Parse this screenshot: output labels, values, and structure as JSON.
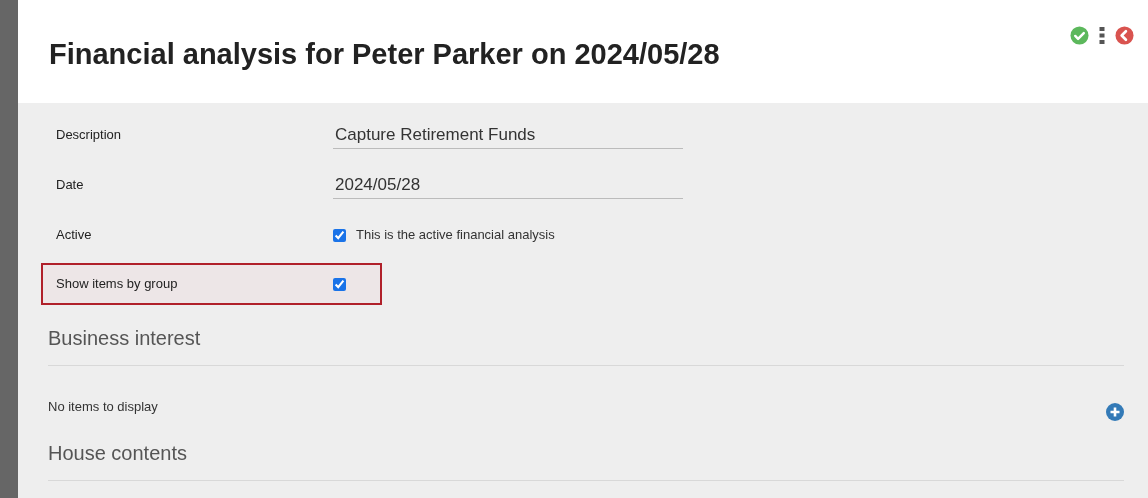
{
  "header": {
    "title": "Financial analysis for Peter Parker on 2024/05/28"
  },
  "fields": [
    {
      "kind": "text",
      "label": "Description",
      "value": "Capture Retirement Funds",
      "highlighted": false
    },
    {
      "kind": "text",
      "label": "Date",
      "value": "2024/05/28",
      "highlighted": false
    },
    {
      "kind": "checkbox",
      "label": "Active",
      "checked": true,
      "caption": "This is the active financial analysis",
      "highlighted": false
    },
    {
      "kind": "checkbox",
      "label": "Show items by group",
      "checked": true,
      "highlighted": true
    }
  ],
  "sections": [
    {
      "title": "Business interest",
      "empty_text": "No items to display"
    },
    {
      "title": "House contents"
    }
  ]
}
